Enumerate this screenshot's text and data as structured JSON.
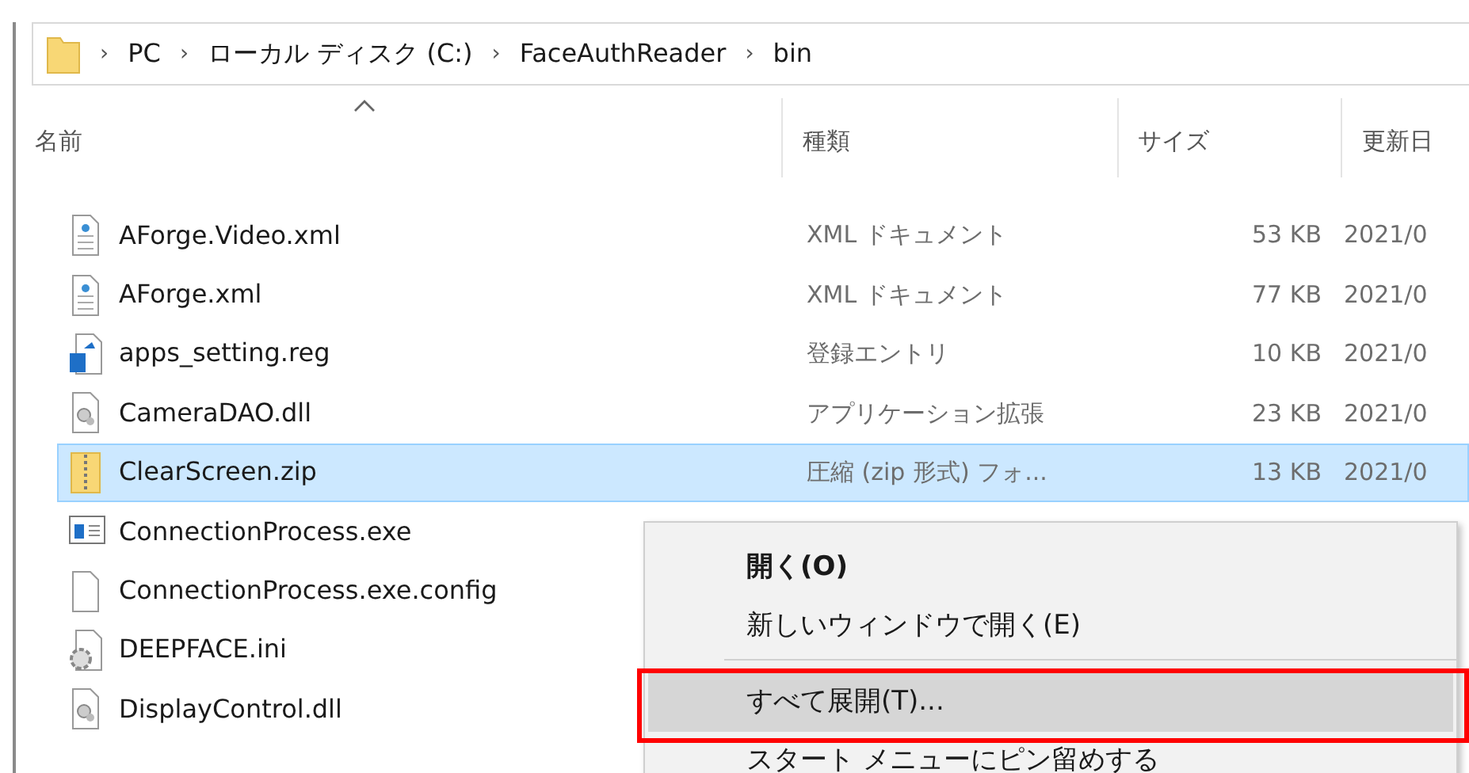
{
  "address_bar": {
    "separator": "›",
    "crumbs": [
      "PC",
      "ローカル ディスク (C:)",
      "FaceAuthReader",
      "bin"
    ]
  },
  "columns": [
    {
      "label": "名前",
      "sorted": true
    },
    {
      "label": "種類",
      "sorted": false
    },
    {
      "label": "サイズ",
      "sorted": false
    },
    {
      "label": "更新日"
    }
  ],
  "files": [
    {
      "name": "AForge.Video.xml",
      "kind": "xml",
      "type": "XML ドキュメント",
      "size": "53 KB",
      "date": "2021/0",
      "selected": false
    },
    {
      "name": "AForge.xml",
      "kind": "xml",
      "type": "XML ドキュメント",
      "size": "77 KB",
      "date": "2021/0",
      "selected": false
    },
    {
      "name": "apps_setting.reg",
      "kind": "reg",
      "type": "登録エントリ",
      "size": "10 KB",
      "date": "2021/0",
      "selected": false
    },
    {
      "name": "CameraDAO.dll",
      "kind": "dll",
      "type": "アプリケーション拡張",
      "size": "23 KB",
      "date": "2021/0",
      "selected": false
    },
    {
      "name": "ClearScreen.zip",
      "kind": "zip",
      "type": "圧縮 (zip 形式) フォ...",
      "size": "13 KB",
      "date": "2021/0",
      "selected": true
    },
    {
      "name": "ConnectionProcess.exe",
      "kind": "exe",
      "selected": false
    },
    {
      "name": "ConnectionProcess.exe.config",
      "kind": "file",
      "selected": false
    },
    {
      "name": "DEEPFACE.ini",
      "kind": "ini",
      "selected": false
    },
    {
      "name": "DisplayControl.dll",
      "kind": "dll",
      "selected": false
    }
  ],
  "context_menu": {
    "items": [
      {
        "label": "開く(O)",
        "bold": true,
        "selected": false,
        "separator_after": false
      },
      {
        "label": "新しいウィンドウで開く(E)",
        "bold": false,
        "selected": false,
        "separator_after": true
      },
      {
        "label": "すべて展開(T)...",
        "bold": false,
        "selected": true,
        "separator_after": false
      },
      {
        "label": "スタート メニューにピン留めする",
        "bold": false,
        "selected": false,
        "separator_after": false
      }
    ]
  }
}
